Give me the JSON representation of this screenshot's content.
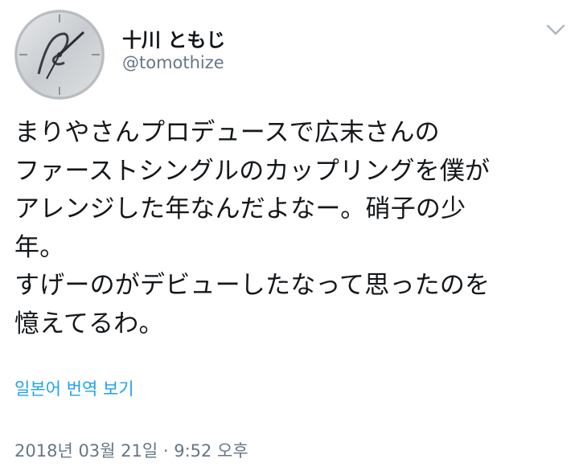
{
  "user": {
    "display_name": "十川 ともじ",
    "handle": "@tomothize",
    "avatar_icon": "clock-face-avatar"
  },
  "tweet": {
    "text": "まりやさんプロデュースで広末さんの\nファーストシングルのカップリングを僕が\nアレンジした年なんだよなー。硝子の少\n年。\nすげーのがデビューしたなって思ったのを\n憶えてるわ。",
    "translate_label": "일본어 번역 보기",
    "timestamp": "2018년 03월 21일 · 9:52 오후"
  },
  "menu": {
    "icon": "chevron-down-icon"
  },
  "colors": {
    "link": "#1da1f2",
    "secondary_text": "#657786",
    "primary_text": "#14171a"
  }
}
